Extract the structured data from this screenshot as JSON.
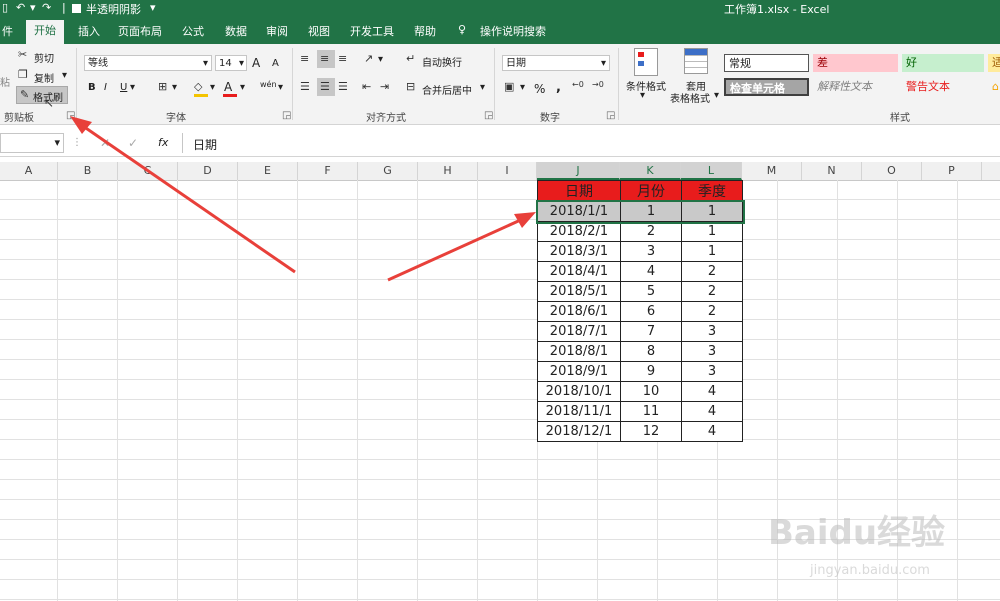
{
  "titlebar": {
    "qat_label": "半透明阴影",
    "title": "工作簿1.xlsx  -  Excel"
  },
  "tabs": [
    {
      "label": "件"
    },
    {
      "label": "开始"
    },
    {
      "label": "插入"
    },
    {
      "label": "页面布局"
    },
    {
      "label": "公式"
    },
    {
      "label": "数据"
    },
    {
      "label": "审阅"
    },
    {
      "label": "视图"
    },
    {
      "label": "开发工具"
    },
    {
      "label": "帮助"
    },
    {
      "label": "操作说明搜索"
    }
  ],
  "clipboard": {
    "cut": "剪切",
    "copy": "复制",
    "format_painter": "格式刷",
    "group_label": "剪贴板",
    "paste_glyph": "粘"
  },
  "font": {
    "name": "等线",
    "size": "14",
    "group_label": "字体",
    "bold": "B",
    "italic": "I",
    "underline": "U",
    "grow": "A",
    "shrink": "A",
    "fill_glyph": "A",
    "phonetic": "wén"
  },
  "align": {
    "wrap": "自动换行",
    "merge": "合并后居中",
    "group_label": "对齐方式"
  },
  "number": {
    "format": "日期",
    "group_label": "数字",
    "percent": "%",
    "comma": ","
  },
  "styles": {
    "cond_format": "条件格式",
    "table_format_1": "套用",
    "table_format_2": "表格格式",
    "group_label": "样式",
    "normal": "常规",
    "bad": "差",
    "good": "好",
    "neutral": "适",
    "check_cell": "检查单元格",
    "explanatory": "解释性文本",
    "warning": "警告文本"
  },
  "formula_bar": {
    "fx": "fx",
    "content": "日期"
  },
  "columns": [
    "A",
    "B",
    "C",
    "D",
    "E",
    "F",
    "G",
    "H",
    "I",
    "J",
    "K",
    "L",
    "M",
    "N",
    "O",
    "P"
  ],
  "table": {
    "headers": [
      "日期",
      "月份",
      "季度"
    ],
    "rows": [
      [
        "2018/1/1",
        "1",
        "1"
      ],
      [
        "2018/2/1",
        "2",
        "1"
      ],
      [
        "2018/3/1",
        "3",
        "1"
      ],
      [
        "2018/4/1",
        "4",
        "2"
      ],
      [
        "2018/5/1",
        "5",
        "2"
      ],
      [
        "2018/6/1",
        "6",
        "2"
      ],
      [
        "2018/7/1",
        "7",
        "3"
      ],
      [
        "2018/8/1",
        "8",
        "3"
      ],
      [
        "2018/9/1",
        "9",
        "3"
      ],
      [
        "2018/10/1",
        "10",
        "4"
      ],
      [
        "2018/11/1",
        "11",
        "4"
      ],
      [
        "2018/12/1",
        "12",
        "4"
      ]
    ]
  },
  "watermark": {
    "brand": "Baidu经验",
    "url": "jingyan.baidu.com"
  },
  "colors": {
    "excel_green": "#217346",
    "header_red": "#e81c1c",
    "arrow_red": "#e8403a"
  }
}
